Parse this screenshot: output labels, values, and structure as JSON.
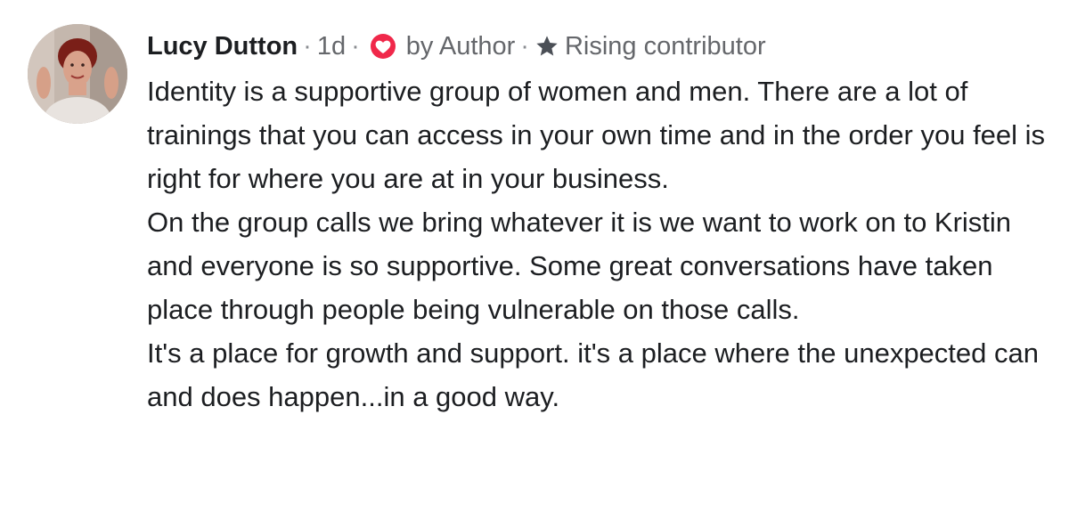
{
  "comment": {
    "author": "Lucy Dutton",
    "separator": "·",
    "time": "1d",
    "reaction_label": "by Author",
    "badge_label": "Rising contributor",
    "icons": {
      "reaction": "heart-icon",
      "badge": "star-icon",
      "reaction_color": "#f0284a"
    },
    "paragraphs": [
      "Identity is a supportive group of women and men. There are a lot of trainings that you can access in your own time and in the order you feel is right for where you are at in your business.",
      "On the group calls we bring whatever it is we want to work on to Kristin and everyone is so supportive. Some great conversations have taken place through people being vulnerable on those calls.",
      "It's a place for growth and support. it's a place where the unexpected can and does happen...in a good way."
    ]
  }
}
